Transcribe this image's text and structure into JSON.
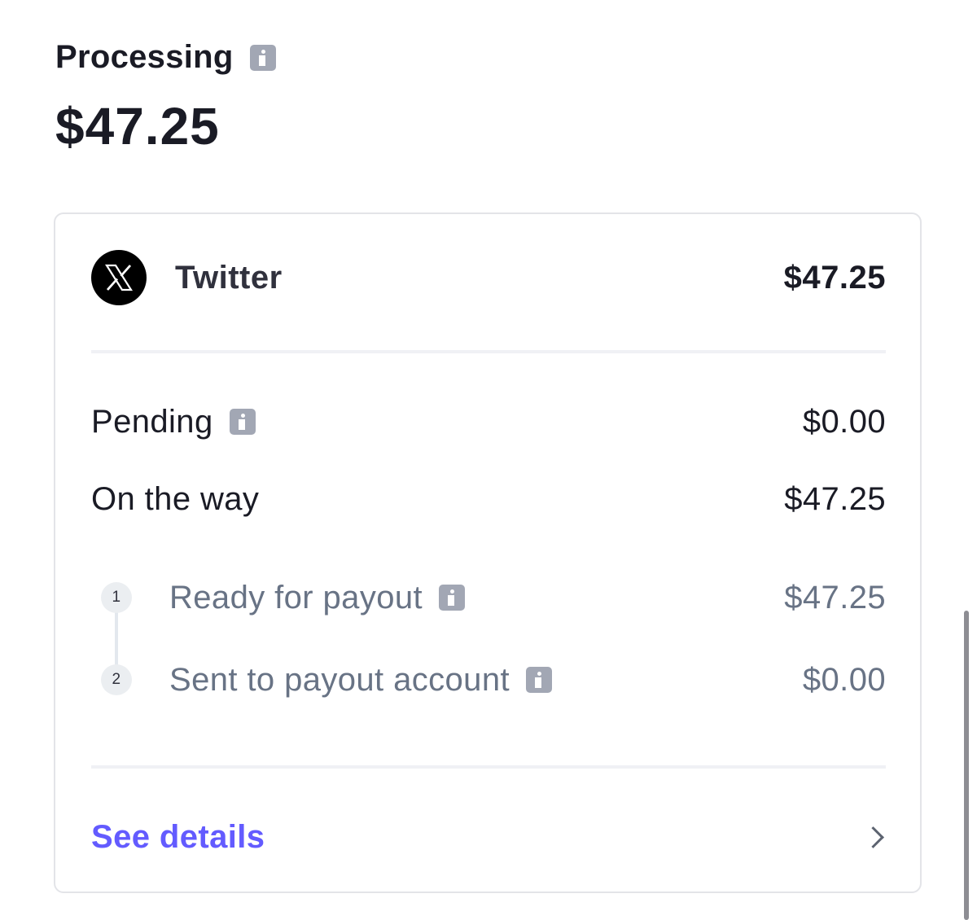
{
  "header": {
    "title": "Processing",
    "amount": "$47.25"
  },
  "source": {
    "name": "Twitter",
    "amount": "$47.25",
    "logo_icon": "x-logo-icon"
  },
  "rows": [
    {
      "label": "Pending",
      "amount": "$0.00",
      "has_info": true
    },
    {
      "label": "On the way",
      "amount": "$47.25",
      "has_info": false
    }
  ],
  "steps": [
    {
      "number": "1",
      "label": "Ready for payout",
      "amount": "$47.25"
    },
    {
      "number": "2",
      "label": "Sent to payout account",
      "amount": "$0.00"
    }
  ],
  "footer": {
    "link_label": "See details",
    "chevron_icon": "chevron-right-icon"
  },
  "colors": {
    "accent": "#635bff",
    "text_primary": "#1a1b25",
    "text_secondary": "#687385",
    "info_icon": "#a2a7b4"
  }
}
